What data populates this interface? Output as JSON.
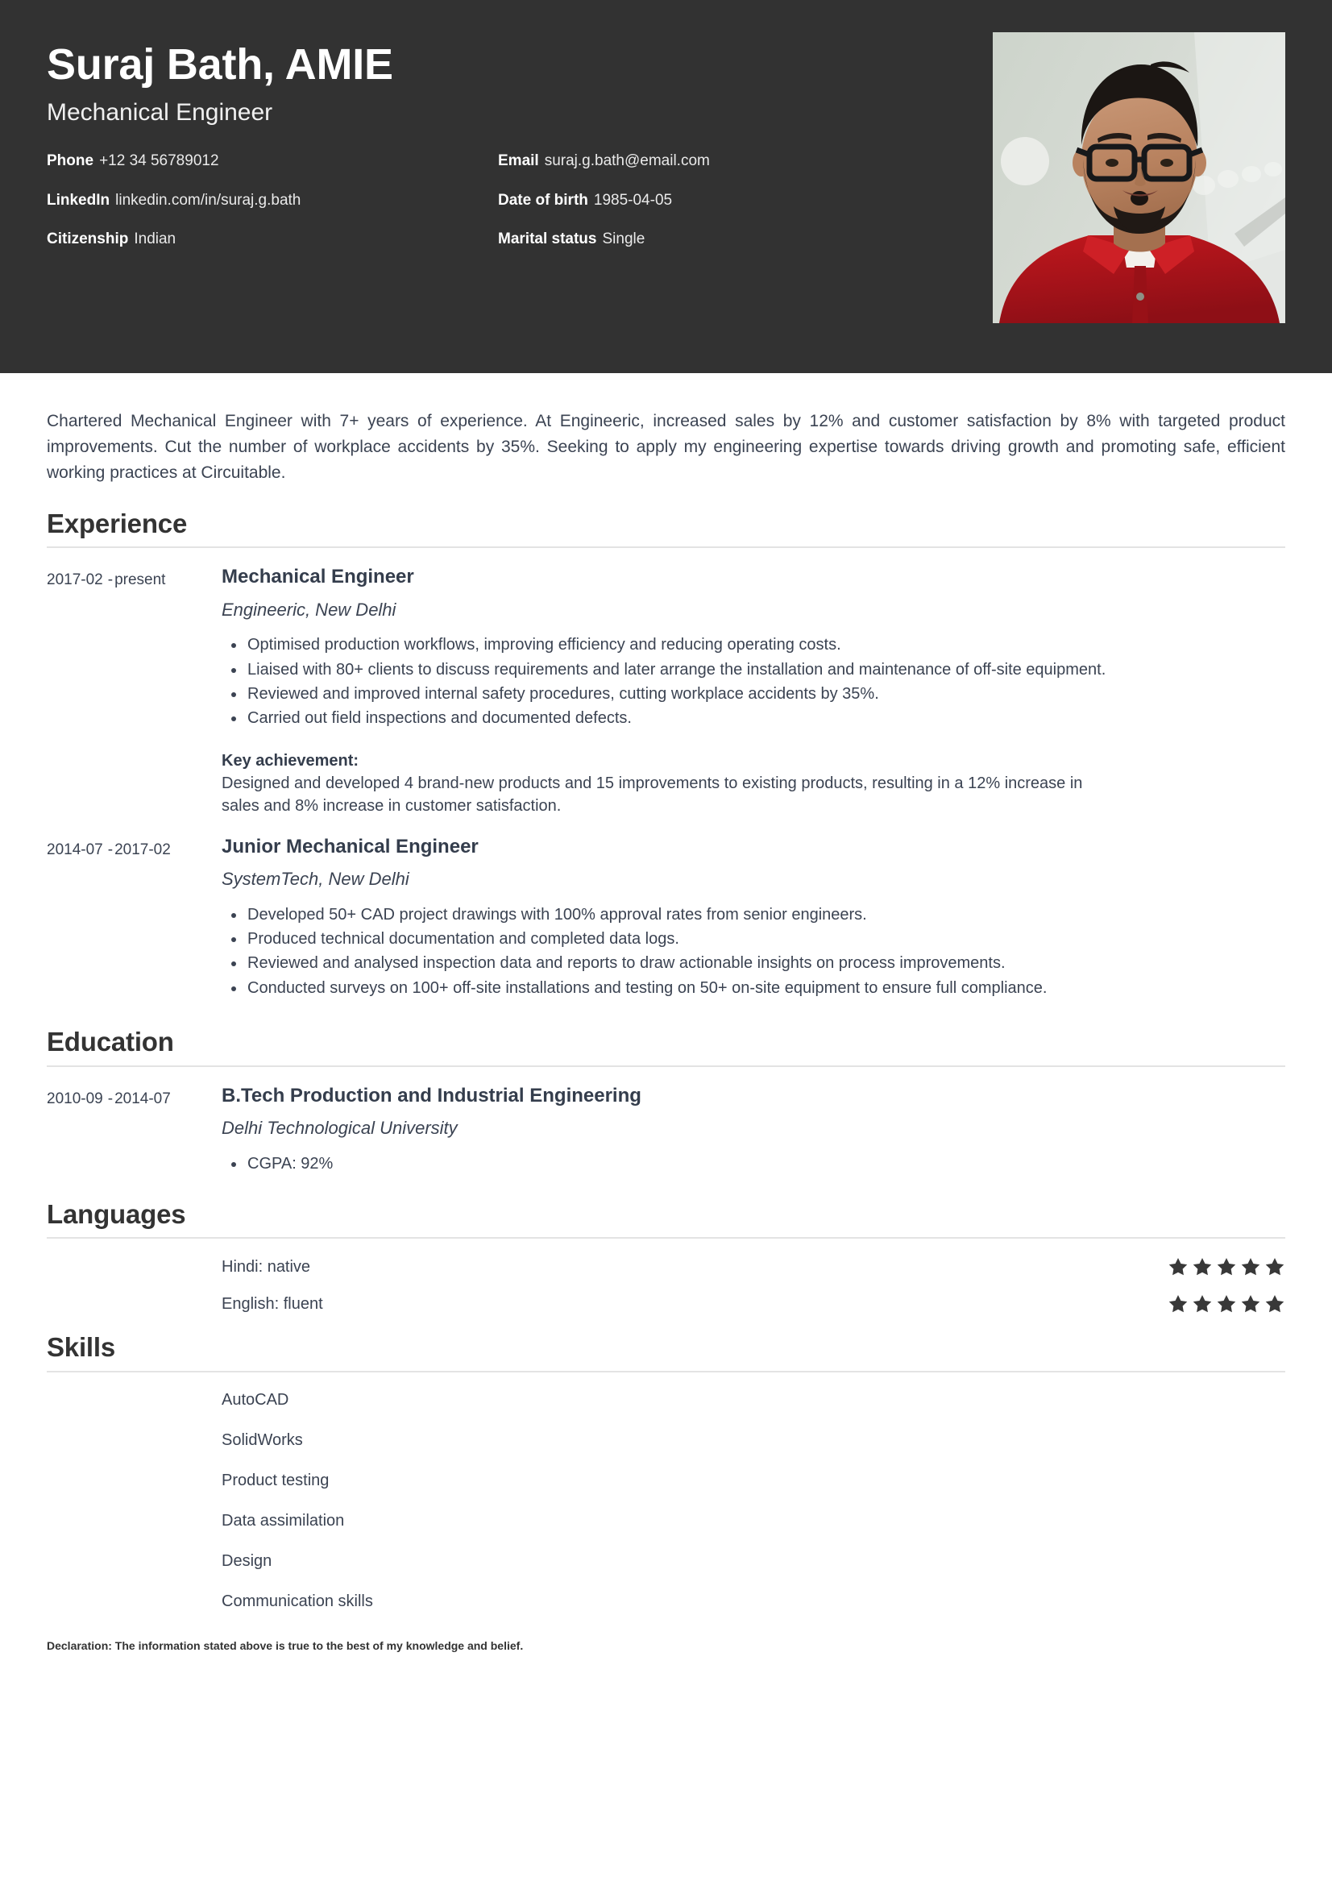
{
  "header": {
    "name": "Suraj Bath, AMIE",
    "job_title": "Mechanical Engineer",
    "background_color": "#323232",
    "contacts": [
      {
        "label": "Phone",
        "value": "+12 34 56789012"
      },
      {
        "label": "Email",
        "value": "suraj.g.bath@email.com"
      },
      {
        "label": "LinkedIn",
        "value": "linkedin.com/in/suraj.g.bath"
      },
      {
        "label": "Date of birth",
        "value": "1985-04-05"
      },
      {
        "label": "Citizenship",
        "value": "Indian"
      },
      {
        "label": "Marital status",
        "value": "Single"
      }
    ],
    "photo_alt": "Portrait photo of a bearded man wearing glasses and a red shirt"
  },
  "summary": "Chartered Mechanical Engineer with 7+ years of experience. At Engineeric, increased sales by 12% and customer satisfaction by 8% with targeted product improvements. Cut the number of workplace accidents by 35%. Seeking to apply my engineering expertise towards driving growth and promoting safe, efficient working practices at Circuitable.",
  "sections": {
    "experience": {
      "title": "Experience",
      "entries": [
        {
          "date_start": "2017-02",
          "date_end": "present",
          "role": "Mechanical Engineer",
          "organization": "Engineeric, New Delhi",
          "bullets": [
            "Optimised production workflows, improving efficiency and reducing operating costs.",
            "Liaised with 80+ clients to discuss requirements and later arrange the installation and maintenance of off-site equipment.",
            "Reviewed and improved internal safety procedures, cutting workplace accidents by 35%.",
            "Carried out field inspections and documented defects."
          ],
          "achievement_label": "Key achievement:",
          "achievement_text": "Designed and developed 4 brand-new products and 15 improvements to existing products, resulting in a 12% increase in sales and 8% increase in customer satisfaction."
        },
        {
          "date_start": "2014-07",
          "date_end": "2017-02",
          "role": "Junior Mechanical Engineer",
          "organization": "SystemTech, New Delhi",
          "bullets": [
            "Developed 50+ CAD project drawings with 100% approval rates from senior engineers.",
            "Produced technical documentation and completed data logs.",
            "Reviewed and analysed inspection data and reports to draw actionable insights on process improvements.",
            "Conducted surveys on 100+ off-site installations and testing on 50+ on-site equipment to ensure full compliance."
          ],
          "achievement_label": "",
          "achievement_text": ""
        }
      ]
    },
    "education": {
      "title": "Education",
      "entries": [
        {
          "date_start": "2010-09",
          "date_end": "2014-07",
          "degree": "B.Tech Production and Industrial Engineering",
          "institution": "Delhi Technological University",
          "bullets": [
            "CGPA: 92%"
          ]
        }
      ]
    },
    "languages": {
      "title": "Languages",
      "max_rating": 5,
      "items": [
        {
          "label": "Hindi: native",
          "rating": 5
        },
        {
          "label": "English: fluent",
          "rating": 5
        }
      ]
    },
    "skills": {
      "title": "Skills",
      "items": [
        "AutoCAD",
        "SolidWorks",
        "Product testing",
        "Data assimilation",
        "Design",
        "Communication skills"
      ]
    }
  },
  "declaration": "Declaration: The information stated above is true to the best of my knowledge and belief.",
  "colors": {
    "header_bg": "#323232",
    "body_text": "#3b4352",
    "heading_text": "#333333",
    "rule": "#e3e3e3",
    "star_fill": "#383838"
  }
}
